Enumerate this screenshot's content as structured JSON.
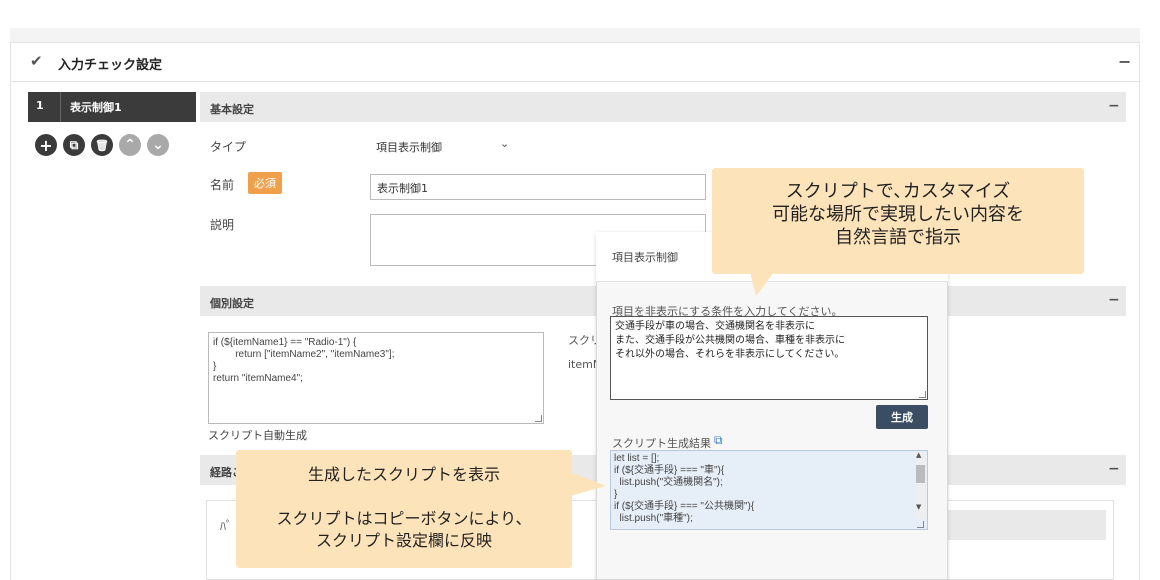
{
  "panel": {
    "title": "入力チェック設定",
    "collapse": "−"
  },
  "nav": {
    "number": "1",
    "label": "表示制御1"
  },
  "icons": {
    "add": "+",
    "copy": "⧉",
    "delete": "🗑",
    "up": "⌃",
    "down": "⌄"
  },
  "basic": {
    "title": "基本設定",
    "type_label": "タイプ",
    "type_value": "項目表示制御",
    "name_label": "名前",
    "required_badge": "必須",
    "name_value": "表示制御1",
    "desc_label": "説明"
  },
  "individual": {
    "title": "個別設定",
    "code": "if (${itemName1} == \"Radio-1\") {\n        return [\"itemName2\", \"itemName3\"];\n}\nreturn \"itemName4\";",
    "auto_link": "スクリプト自動生成",
    "right_label1": "スクリ",
    "right_label2": "itemN"
  },
  "route": {
    "title": "経路こ",
    "inner_label": "ﾊﾟ ﾛ"
  },
  "popup": {
    "title": "項目表示制御",
    "prompt_label": "項目を非表示にする条件を入力してください。",
    "prompt_text": "交通手段が車の場合、交通機関名を非表示に\nまた、交通手段が公共機関の場合、車種を非表示に\nそれ以外の場合、それらを非表示にしてください。",
    "generate": "生成",
    "result_label": "スクリプト生成結果",
    "result_code": "let list = [];\nif (${交通手段} === \"車\"){\n  list.push(\"交通機関名\");\n}\nif (${交通手段} === \"公共機関\"){\n  list.push(\"車種\");"
  },
  "callouts": {
    "top_line1": "スクリプトで､カスタマイズ",
    "top_line2": "可能な場所で実現したい内容を",
    "top_line3": "自然言語で指示",
    "bottom_line1": "生成したスクリプトを表示",
    "bottom_line2": "スクリプトはコピーボタンにより、",
    "bottom_line3": "スクリプト設定欄に反映"
  },
  "colors": {
    "nav_dark": "#3b3b3b",
    "badge": "#f0a04b",
    "callout": "#fde3ba",
    "button": "#3a4d63",
    "result_bg": "#e6eef8"
  }
}
